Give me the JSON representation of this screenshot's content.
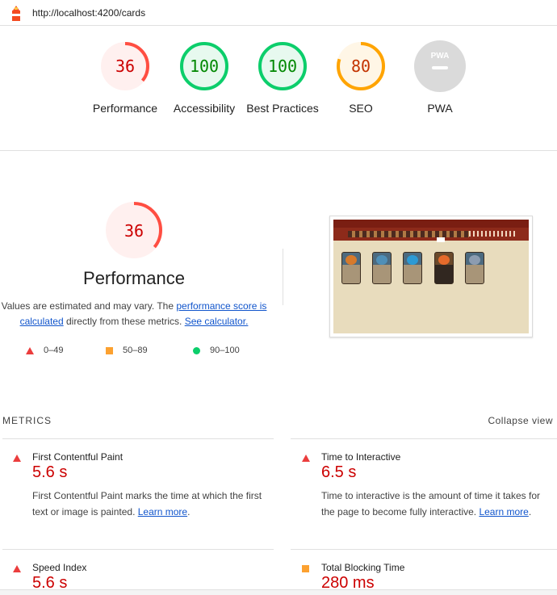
{
  "header": {
    "url": "http://localhost:4200/cards",
    "logo_icon": "lighthouse-icon"
  },
  "colors": {
    "fail": "#ff4e42",
    "average": "#ffa400",
    "pass": "#0cce6b",
    "pwa": "#cccccc"
  },
  "gauges": [
    {
      "score": "36",
      "label": "Performance",
      "status": "fail",
      "fraction": 0.36
    },
    {
      "score": "100",
      "label": "Accessibility",
      "status": "pass",
      "fraction": 1.0
    },
    {
      "score": "100",
      "label": "Best Practices",
      "status": "pass",
      "fraction": 1.0
    },
    {
      "score": "80",
      "label": "SEO",
      "status": "average",
      "fraction": 0.8
    },
    {
      "score": "PWA",
      "label": "PWA",
      "status": "pwa",
      "fraction": 0
    }
  ],
  "performance": {
    "score": "36",
    "fraction": 0.36,
    "title": "Performance",
    "desc_prefix": "Values are estimated and may vary. The ",
    "desc_link1": "performance score is calculated",
    "desc_middle": " directly from these metrics. ",
    "desc_link2": "See calculator."
  },
  "legend": {
    "fail": "0–49",
    "average": "50–89",
    "pass": "90–100"
  },
  "metrics_section": {
    "heading": "METRICS",
    "toggle": "Collapse view"
  },
  "metrics": [
    {
      "title": "First Contentful Paint",
      "value": "5.6 s",
      "desc": "First Contentful Paint marks the time at which the first text or image is painted. ",
      "link": "Learn more",
      "suffix": ".",
      "status": "fail"
    },
    {
      "title": "Time to Interactive",
      "value": "6.5 s",
      "desc": "Time to interactive is the amount of time it takes for the page to become fully interactive. ",
      "link": "Learn more",
      "suffix": ".",
      "status": "fail"
    },
    {
      "title": "Speed Index",
      "value": "5.6 s",
      "status": "fail"
    },
    {
      "title": "Total Blocking Time",
      "value": "280 ms",
      "status": "average"
    }
  ]
}
